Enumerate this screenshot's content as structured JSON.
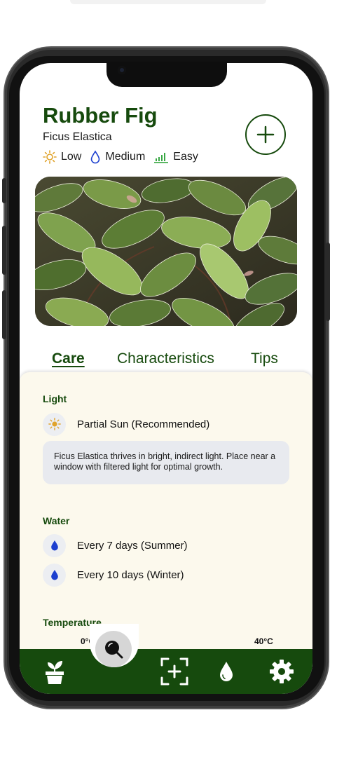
{
  "plant": {
    "common_name": "Rubber Fig",
    "scientific_name": "Ficus Elastica",
    "light_level": "Low",
    "water_level": "Medium",
    "difficulty": "Easy"
  },
  "tabs": [
    {
      "label": "Care",
      "active": true
    },
    {
      "label": "Characteristics",
      "active": false
    },
    {
      "label": "Tips",
      "active": false
    }
  ],
  "care": {
    "light": {
      "heading": "Light",
      "value": "Partial Sun (Recommended)",
      "tip": "Ficus Elastica thrives in bright, indirect light. Place near a window with filtered light for optimal growth."
    },
    "water": {
      "heading": "Water",
      "items": [
        "Every 7 days (Summer)",
        "Every 10 days (Winter)"
      ]
    },
    "temperature": {
      "heading": "Temperature",
      "min": "0°C",
      "max": "40°C"
    }
  },
  "icons": {
    "add": "plus-circle-icon",
    "light": "sun-icon",
    "water": "drop-icon",
    "difficulty": "difficulty-bars-icon",
    "nav": [
      "plant-pot-icon",
      "search-icon",
      "scan-icon",
      "water-drop-icon",
      "gear-icon"
    ]
  },
  "colors": {
    "primary": "#164a0d",
    "sun": "#e0a32a",
    "water": "#1c3fcf",
    "difficulty": "#3aa845",
    "panel_bg": "#fcf9ed",
    "tip_bg": "#e8eaef"
  }
}
